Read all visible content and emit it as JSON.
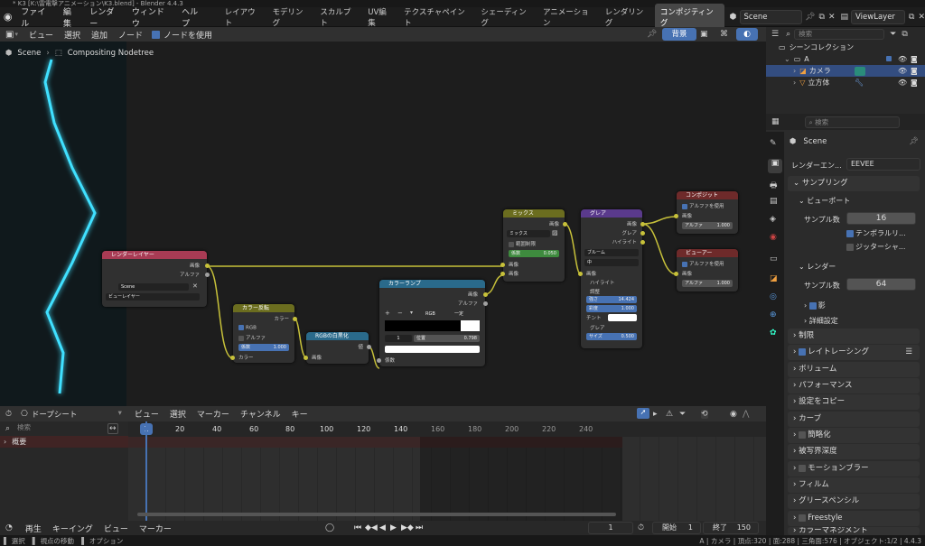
{
  "titlebar": {
    "title": "* K3 [K:\\雷電撃アニメーション\\K3.blend] - Blender 4.4.3"
  },
  "menu": {
    "items": [
      "ファイル",
      "編集",
      "レンダー",
      "ウィンドウ",
      "ヘルプ"
    ]
  },
  "workspaces": [
    "レイアウト",
    "モデリング",
    "スカルプト",
    "UV編集",
    "テクスチャペイント",
    "シェーディング",
    "アニメーション",
    "レンダリング",
    "コンポジティング"
  ],
  "active_workspace": "コンポジティング",
  "scene_field": "Scene",
  "viewlayer_field": "ViewLayer",
  "node_editor": {
    "menus": [
      "ビュー",
      "選択",
      "追加",
      "ノード"
    ],
    "use_nodes_label": "ノードを使用",
    "backdrop_label": "背景",
    "breadcrumb": [
      "Scene",
      "Compositing Nodetree"
    ]
  },
  "nodes": {
    "render_layers": {
      "title": "レンダーレイヤー",
      "out_image": "画像",
      "out_alpha": "アルファ",
      "scene": "Scene",
      "layer": "ビューレイヤー"
    },
    "color_balance": {
      "title": "カラー反転",
      "out_color": "カラー",
      "rgb": "RGB",
      "alpha": "アルファ",
      "fac_label": "係数",
      "fac_value": "1.000",
      "in_color": "カラー"
    },
    "rgb_to_bw": {
      "title": "RGBの白黒化",
      "out": "値",
      "in": "画像"
    },
    "color_ramp": {
      "title": "カラーランプ",
      "out_image": "画像",
      "out_alpha": "アルファ",
      "mode": "RGB",
      "interp": "一定",
      "index": "1",
      "pos_label": "位置",
      "pos_value": "0.798",
      "in": "係数"
    },
    "mix": {
      "title": "ミックス",
      "out": "画像",
      "blend": "ミックス",
      "clamp": "範囲制限",
      "fac_label": "係数",
      "fac_value": "0.050",
      "in1": "画像",
      "in2": "画像"
    },
    "glare": {
      "title": "グレア",
      "out_image": "画像",
      "out_glare": "グレア",
      "out_high": "ハイライト",
      "type": "ブルーム",
      "quality": "中",
      "in_image": "画像",
      "sec_high": "ハイライト",
      "sec_adjust": "調整",
      "strength_label": "強さ",
      "strength_value": "14.424",
      "sat_label": "彩度",
      "sat_value": "1.000",
      "tint": "チント",
      "sec_glare": "グレア",
      "size_label": "サイズ",
      "size_value": "0.500"
    },
    "composite": {
      "title": "コンポジット",
      "use_alpha": "アルファを使用",
      "in_image": "画像",
      "alpha_label": "アルファ",
      "alpha_value": "1.000"
    },
    "viewer": {
      "title": "ビューアー",
      "use_alpha": "アルファを使用",
      "in_image": "画像",
      "alpha_label": "アルファ",
      "alpha_value": "1.000"
    }
  },
  "outliner": {
    "search_placeholder": "検索",
    "collection": "シーンコレクション",
    "items": [
      {
        "label": "A"
      },
      {
        "label": "カメラ"
      },
      {
        "label": "立方体"
      }
    ]
  },
  "properties": {
    "search_placeholder": "検索",
    "scene": "Scene",
    "engine_label": "レンダーエン...",
    "engine_value": "EEVEE",
    "sampling": "サンプリング",
    "viewport": "ビューポート",
    "samples_label": "サンプル数",
    "viewport_samples": "16",
    "temporal": "テンポラルリ...",
    "jitter": "ジッターシャ...",
    "render": "レンダー",
    "render_samples": "64",
    "shadow": "影",
    "details": "詳細設定",
    "sections": [
      "制限",
      "レイトレーシング",
      "ボリューム",
      "パフォーマンス",
      "設定をコピー",
      "カーブ",
      "簡略化",
      "被写界深度",
      "モーションブラー",
      "フィルム",
      "グリースペンシル",
      "Freestyle",
      "カラーマネジメント"
    ]
  },
  "dopesheet": {
    "mode": "ドープシート",
    "menus": [
      "ビュー",
      "選択",
      "マーカー",
      "チャンネル",
      "キー"
    ],
    "search_placeholder": "検索",
    "summary": "概要",
    "frame_ticks": [
      "1",
      "20",
      "40",
      "60",
      "80",
      "100",
      "120",
      "140",
      "160",
      "180",
      "200",
      "220",
      "240"
    ]
  },
  "playback": {
    "menus": [
      "再生",
      "キーイング",
      "ビュー",
      "マーカー"
    ],
    "current_frame": "1",
    "start_label": "開始",
    "start": "1",
    "end_label": "終了",
    "end": "150"
  },
  "statusbar": {
    "left": [
      "選択",
      "視点の移動",
      "オプション"
    ],
    "right": "A | カメラ | 頂点:320 | 面:288 | 三角面:576 | オブジェクト:1/2 | 4.4.3"
  },
  "colors": {
    "accent": "#4772b3",
    "lightning": "#3fe0ff",
    "wire": "#c7c13a",
    "header_active": "#474747"
  }
}
